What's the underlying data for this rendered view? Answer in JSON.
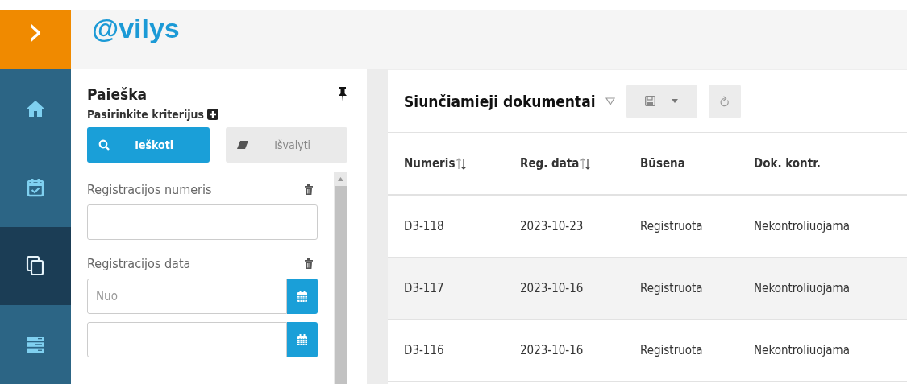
{
  "header": {
    "logo": "@vilys",
    "toggle": "›"
  },
  "nav": [
    {
      "kind": "home",
      "selected": false
    },
    {
      "kind": "calendar",
      "selected": false
    },
    {
      "kind": "documents",
      "selected": true
    },
    {
      "kind": "list",
      "selected": false
    }
  ],
  "search_panel": {
    "title": "Paieška",
    "subtitle": "Pasirinkite kriterijus",
    "search_button": "Ieškoti",
    "clear_button": "Išvalyti",
    "fields": [
      {
        "label": "Registracijos numeris",
        "inputs": [
          {
            "kind": "text"
          }
        ]
      },
      {
        "label": "Registracijos data",
        "inputs": [
          {
            "kind": "date",
            "placeholder": "Nuo"
          },
          {
            "kind": "date"
          }
        ]
      }
    ]
  },
  "table": {
    "title": "Siunčiamieji dokumentai",
    "columns": [
      {
        "label": "Numeris",
        "sortable": true
      },
      {
        "label": "Reg. data",
        "sortable": true
      },
      {
        "label": "Būsena",
        "sortable": false
      },
      {
        "label": "Dok. kontr.",
        "sortable": false
      }
    ],
    "rows": [
      [
        "D3-118",
        "2023-10-23",
        "Registruota",
        "Nekontroliuojama"
      ],
      [
        "D3-117",
        "2023-10-16",
        "Registruota",
        "Nekontroliuojama"
      ],
      [
        "D3-116",
        "2023-10-16",
        "Registruota",
        "Nekontroliuojama"
      ]
    ]
  }
}
